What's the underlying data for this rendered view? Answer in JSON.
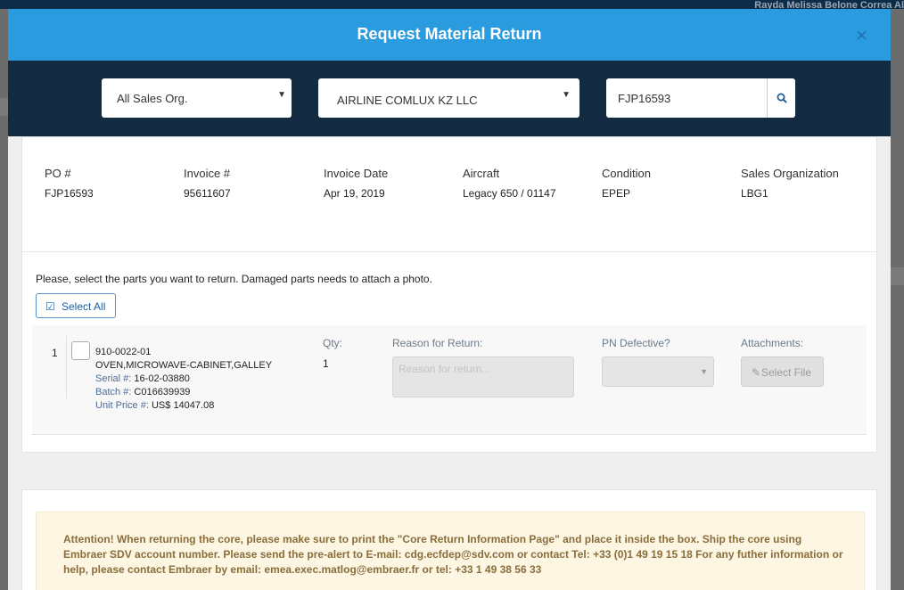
{
  "background": {
    "user_name": "Rayda Melissa Belone Correa Al"
  },
  "modal": {
    "title": "Request Material Return",
    "close_glyph": "×"
  },
  "filters": {
    "sales_org": "All Sales Org.",
    "customer": "AIRLINE COMLUX KZ LLC",
    "search_value": "FJP16593"
  },
  "order_info": {
    "po_label": "PO #",
    "po_value": "FJP16593",
    "invoice_label": "Invoice #",
    "invoice_value": "95611607",
    "invoice_date_label": "Invoice Date",
    "invoice_date_value": "Apr 19, 2019",
    "aircraft_label": "Aircraft",
    "aircraft_value": "Legacy 650 / 01147",
    "condition_label": "Condition",
    "condition_value": "EPEP",
    "sales_org_label": "Sales Organization",
    "sales_org_value": "LBG1"
  },
  "instructions": "Please, select the parts you want to return. Damaged parts needs to attach a photo.",
  "select_all_label": "Select All",
  "columns": {
    "qty": "Qty:",
    "reason": "Reason for Return:",
    "pn_defective": "PN Defective?",
    "attachments": "Attachments:"
  },
  "parts": [
    {
      "index": "1",
      "part_number": "910-0022-01",
      "description": "OVEN,MICROWAVE-CABINET,GALLEY",
      "serial_label": "Serial #:",
      "serial_value": "16-02-03880",
      "batch_label": "Batch #:",
      "batch_value": "C016639939",
      "price_label": "Unit Price #:",
      "price_value": "US$ 14047.08",
      "qty": "1",
      "reason_placeholder": "Reason for return...",
      "file_button": "Select File"
    }
  ],
  "attention": "Attention! When returning the core, please make sure to print the \"Core Return Information Page\" and place it inside the box. Ship the core using Embraer SDV account number. Please send the pre-alert to E-mail: cdg.ecfdep@sdv.com or contact Tel: +33 (0)1 49 19 15 18 For any futher information or help, please contact Embraer by email: emea.exec.matlog@embraer.fr or tel: +33 1 49 38 56 33"
}
